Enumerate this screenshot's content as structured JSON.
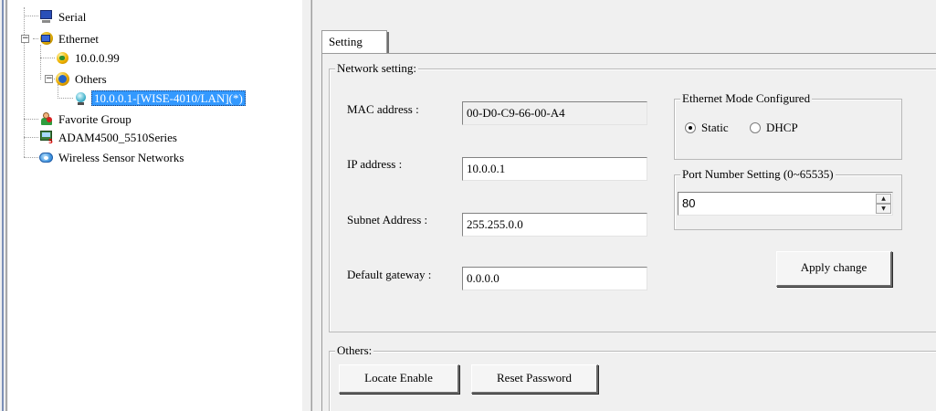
{
  "tree": {
    "items": [
      {
        "label": "Serial",
        "icon": "serial-icon"
      },
      {
        "label": "Ethernet",
        "icon": "ethernet-icon"
      },
      {
        "label": "10.0.0.99",
        "icon": "ip-device-icon"
      },
      {
        "label": "Others",
        "icon": "others-icon"
      },
      {
        "label": "10.0.0.1-[WISE-4010/LAN](*)",
        "icon": "device-icon",
        "selected": true
      },
      {
        "label": "Favorite Group",
        "icon": "favorite-group-icon"
      },
      {
        "label": "ADAM4500_5510Series",
        "icon": "adam-series-icon"
      },
      {
        "label": "Wireless Sensor Networks",
        "icon": "wireless-sensor-icon"
      }
    ],
    "selected_color": "#3399ff"
  },
  "tabs": [
    {
      "label": "Setting",
      "active": true
    }
  ],
  "network": {
    "group_title": "Network setting:",
    "mac_label": "MAC address :",
    "mac_value": "00-D0-C9-66-00-A4",
    "ip_label": "IP address :",
    "ip_value": "10.0.0.1",
    "subnet_label": "Subnet Address :",
    "subnet_value": "255.255.0.0",
    "gateway_label": "Default gateway :",
    "gateway_value": "0.0.0.0",
    "mode_group_title": "Ethernet Mode Configured",
    "mode_options": [
      {
        "label": "Static",
        "selected": true
      },
      {
        "label": "DHCP",
        "selected": false
      }
    ],
    "port_group_title": "Port Number Setting (0~65535)",
    "port_value": "80",
    "apply_button": "Apply change"
  },
  "others": {
    "group_title": "Others:",
    "locate_button": "Locate Enable",
    "reset_button": "Reset Password"
  }
}
